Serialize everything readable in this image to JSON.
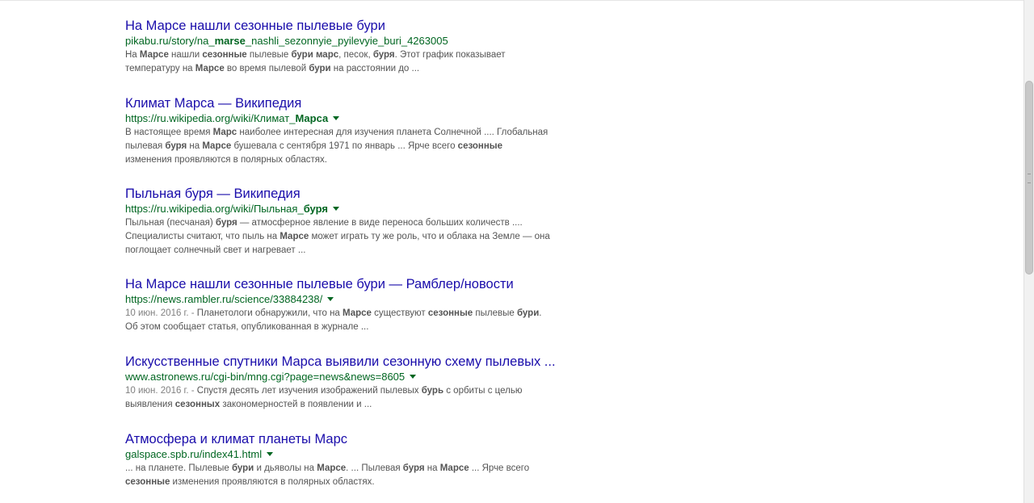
{
  "results": [
    {
      "title": "На Марсе нашли сезонные пылевые бури",
      "url_parts": [
        {
          "t": "pikabu.ru/story/na_",
          "b": false
        },
        {
          "t": "marse",
          "b": true
        },
        {
          "t": "_nashli_sezonnyie_pyilevyie_buri_4263005",
          "b": false
        }
      ],
      "has_caret": false,
      "snippet_lines": [
        [
          {
            "t": "На ",
            "b": false
          },
          {
            "t": "Марсе",
            "b": true
          },
          {
            "t": " нашли ",
            "b": false
          },
          {
            "t": "сезонные",
            "b": true
          },
          {
            "t": " пылевые ",
            "b": false
          },
          {
            "t": "бури марс",
            "b": true
          },
          {
            "t": ", песок, ",
            "b": false
          },
          {
            "t": "буря",
            "b": true
          },
          {
            "t": ". Этот график показывает",
            "b": false
          }
        ],
        [
          {
            "t": "температуру на ",
            "b": false
          },
          {
            "t": "Марсе",
            "b": true
          },
          {
            "t": " во время пылевой ",
            "b": false
          },
          {
            "t": "бури",
            "b": true
          },
          {
            "t": " на расстоянии до ...",
            "b": false
          }
        ]
      ]
    },
    {
      "title": "Климат Марса — Википедия",
      "url_parts": [
        {
          "t": "https://ru.wikipedia.org/wiki/Климат_",
          "b": false
        },
        {
          "t": "Марса",
          "b": true
        }
      ],
      "has_caret": true,
      "snippet_lines": [
        [
          {
            "t": "В настоящее время ",
            "b": false
          },
          {
            "t": "Марс",
            "b": true
          },
          {
            "t": " наиболее интересная для изучения планета Солнечной .... Глобальная",
            "b": false
          }
        ],
        [
          {
            "t": "пылевая ",
            "b": false
          },
          {
            "t": "буря",
            "b": true
          },
          {
            "t": " на ",
            "b": false
          },
          {
            "t": "Марсе",
            "b": true
          },
          {
            "t": " бушевала с сентября 1971 по январь ... Ярче всего ",
            "b": false
          },
          {
            "t": "сезонные",
            "b": true
          }
        ],
        [
          {
            "t": "изменения проявляются в полярных областях.",
            "b": false
          }
        ]
      ]
    },
    {
      "title": "Пыльная буря — Википедия",
      "url_parts": [
        {
          "t": "https://ru.wikipedia.org/wiki/Пыльная_",
          "b": false
        },
        {
          "t": "буря",
          "b": true
        }
      ],
      "has_caret": true,
      "snippet_lines": [
        [
          {
            "t": "Пыльная (песчаная) ",
            "b": false
          },
          {
            "t": "буря",
            "b": true
          },
          {
            "t": " — атмосферное явление в виде переноса больших количеств ....",
            "b": false
          }
        ],
        [
          {
            "t": "Специалисты считают, что пыль на ",
            "b": false
          },
          {
            "t": "Марсе",
            "b": true
          },
          {
            "t": " может играть ту же роль, что и облака на Земле — она",
            "b": false
          }
        ],
        [
          {
            "t": "поглощает солнечный свет и нагревает ...",
            "b": false
          }
        ]
      ]
    },
    {
      "title": "На Марсе нашли сезонные пылевые бури — Рамблер/новости",
      "url_parts": [
        {
          "t": "https://news.rambler.ru/science/33884238/",
          "b": false
        }
      ],
      "has_caret": true,
      "snippet_lines": [
        [
          {
            "t": "10 июн. 2016 г. - ",
            "b": false,
            "date": true
          },
          {
            "t": "Планетологи обнаружили, что на ",
            "b": false
          },
          {
            "t": "Марсе",
            "b": true
          },
          {
            "t": " существуют ",
            "b": false
          },
          {
            "t": "сезонные",
            "b": true
          },
          {
            "t": " пылевые ",
            "b": false
          },
          {
            "t": "бури",
            "b": true
          },
          {
            "t": ".",
            "b": false
          }
        ],
        [
          {
            "t": "Об этом сообщает статья, опубликованная в журнале ...",
            "b": false
          }
        ]
      ]
    },
    {
      "title": "Искусственные спутники Марса выявили сезонную схему пылевых ...",
      "url_parts": [
        {
          "t": "www.astronews.ru/cgi-bin/mng.cgi?page=news&news=8605",
          "b": false
        }
      ],
      "has_caret": true,
      "snippet_lines": [
        [
          {
            "t": "10 июн. 2016 г. - ",
            "b": false,
            "date": true
          },
          {
            "t": "Спустя десять лет изучения изображений пылевых ",
            "b": false
          },
          {
            "t": "бурь",
            "b": true
          },
          {
            "t": " с орбиты с целью",
            "b": false
          }
        ],
        [
          {
            "t": "выявления ",
            "b": false
          },
          {
            "t": "сезонных",
            "b": true
          },
          {
            "t": " закономерностей в появлении и ...",
            "b": false
          }
        ]
      ]
    },
    {
      "title": "Атмосфера и климат планеты Марс",
      "url_parts": [
        {
          "t": "galspace.spb.ru/index41.html",
          "b": false
        }
      ],
      "has_caret": true,
      "snippet_lines": [
        [
          {
            "t": "... на планете. Пылевые ",
            "b": false
          },
          {
            "t": "бури",
            "b": true
          },
          {
            "t": " и дьяволы на ",
            "b": false
          },
          {
            "t": "Марсе",
            "b": true
          },
          {
            "t": ". ... Пылевая ",
            "b": false
          },
          {
            "t": "буря",
            "b": true
          },
          {
            "t": " на ",
            "b": false
          },
          {
            "t": "Марсе",
            "b": true
          },
          {
            "t": " ... Ярче всего",
            "b": false
          }
        ],
        [
          {
            "t": "сезонные",
            "b": true
          },
          {
            "t": " изменения проявляются в полярных областях.",
            "b": false
          }
        ]
      ]
    }
  ]
}
